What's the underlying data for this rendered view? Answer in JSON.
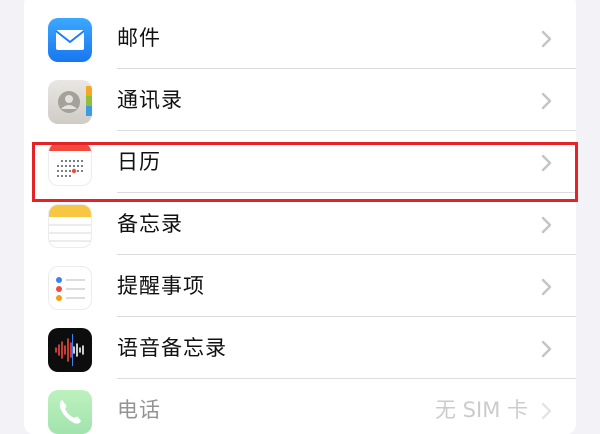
{
  "settings_list": {
    "items": [
      {
        "label": "邮件",
        "icon": "mail-icon"
      },
      {
        "label": "通讯录",
        "icon": "contacts-icon"
      },
      {
        "label": "日历",
        "icon": "calendar-icon"
      },
      {
        "label": "备忘录",
        "icon": "notes-icon"
      },
      {
        "label": "提醒事项",
        "icon": "reminders-icon"
      },
      {
        "label": "语音备忘录",
        "icon": "voice-memos-icon"
      },
      {
        "label": "电话",
        "icon": "phone-icon",
        "value": "无 SIM 卡"
      }
    ]
  },
  "colors": {
    "highlight": "#e52226",
    "chevron": "#c4c4c8",
    "background": "#f2f2f7"
  }
}
